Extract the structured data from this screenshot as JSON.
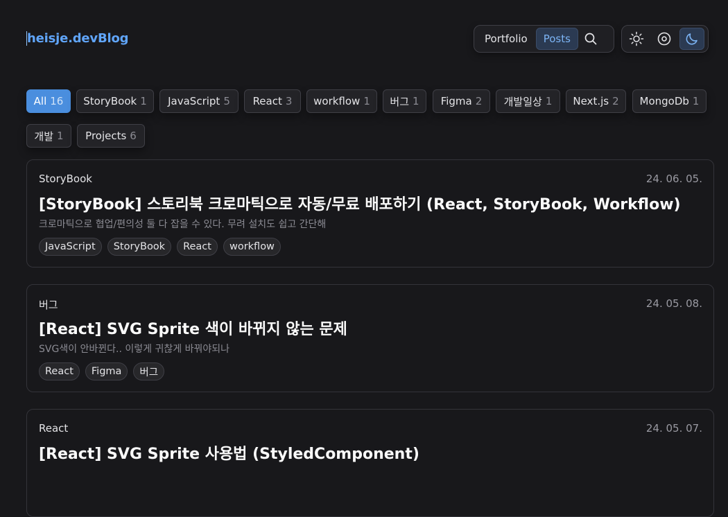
{
  "header": {
    "logo": "heisje.devBlog",
    "nav": [
      {
        "label": "Portfolio",
        "active": false
      },
      {
        "label": "Posts",
        "active": true
      }
    ],
    "search_icon": "search-icon",
    "theme_icons": [
      "sun-icon",
      "system-icon",
      "moon-icon"
    ],
    "accent_color": "#60a5fa"
  },
  "categories": [
    {
      "name": "All",
      "count": "16",
      "active": true
    },
    {
      "name": "StoryBook",
      "count": "1"
    },
    {
      "name": "JavaScript",
      "count": "5"
    },
    {
      "name": "React",
      "count": "3"
    },
    {
      "name": "workflow",
      "count": "1"
    },
    {
      "name": "버그",
      "count": "1"
    },
    {
      "name": "Figma",
      "count": "2"
    },
    {
      "name": "개발일상",
      "count": "1"
    },
    {
      "name": "Next.js",
      "count": "2"
    },
    {
      "name": "MongoDb",
      "count": "1"
    },
    {
      "name": "개발",
      "count": "1"
    },
    {
      "name": "Projects",
      "count": "6"
    }
  ],
  "posts": [
    {
      "category": "StoryBook",
      "date": "24. 06. 05.",
      "title": "[StoryBook] 스토리북 크로마틱으로 자동/무료 배포하기 (React, StoryBook, Workflow)",
      "description": "크로마틱으로 협업/편의성 둘 다 잡을 수 있다. 무려 설치도 쉽고 간단해",
      "tags": [
        "JavaScript",
        "StoryBook",
        "React",
        "workflow"
      ]
    },
    {
      "category": "버그",
      "date": "24. 05. 08.",
      "title": "[React] SVG Sprite 색이 바뀌지 않는 문제",
      "description": "SVG색이 안바뀐다.. 이렇게 귀찮게 바꿔야되나",
      "tags": [
        "React",
        "Figma",
        "버그"
      ]
    },
    {
      "category": "React",
      "date": "24. 05. 07.",
      "title": "[React] SVG Sprite 사용법 (StyledComponent)",
      "description": "",
      "tags": []
    }
  ]
}
